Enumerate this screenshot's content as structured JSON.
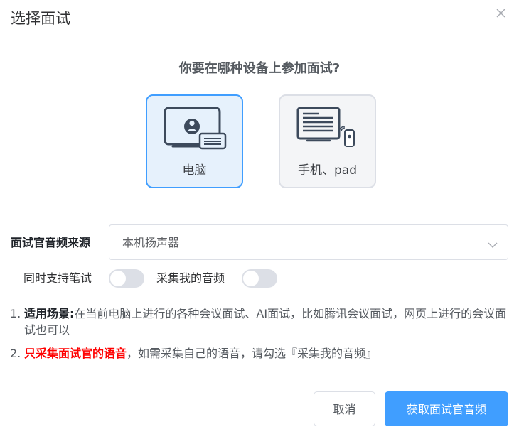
{
  "dialog": {
    "title": "选择面试",
    "close_icon": "close-icon"
  },
  "question": "你要在哪种设备上参加面试?",
  "devices": [
    {
      "label": "电脑",
      "icon": "computer-icon",
      "selected": true
    },
    {
      "label": "手机、pad",
      "icon": "mobile-device-icon",
      "selected": false
    }
  ],
  "audio_source": {
    "label": "面试官音频来源",
    "value": "本机扬声器",
    "dropdown_icon": "chevron-down-icon"
  },
  "options": {
    "written_test": {
      "label": "同时支持笔试",
      "on": false
    },
    "capture_my_audio": {
      "label": "采集我的音频",
      "on": false
    }
  },
  "notes": [
    {
      "num": "1.",
      "bold": "适用场景:",
      "text": "在当前电脑上进行的各种会议面试、AI面试，比如腾讯会议面试，网页上进行的会议面试也可以"
    },
    {
      "num": "2.",
      "bold": "只采集面试官的语音",
      "text": "，如需采集自己的语音，请勾选『采集我的音频』"
    }
  ],
  "buttons": {
    "cancel": "取消",
    "confirm": "获取面试官音频"
  },
  "colors": {
    "accent": "#409eff",
    "selected_bg": "#e6f1fc",
    "warning_red": "#ff0000"
  }
}
